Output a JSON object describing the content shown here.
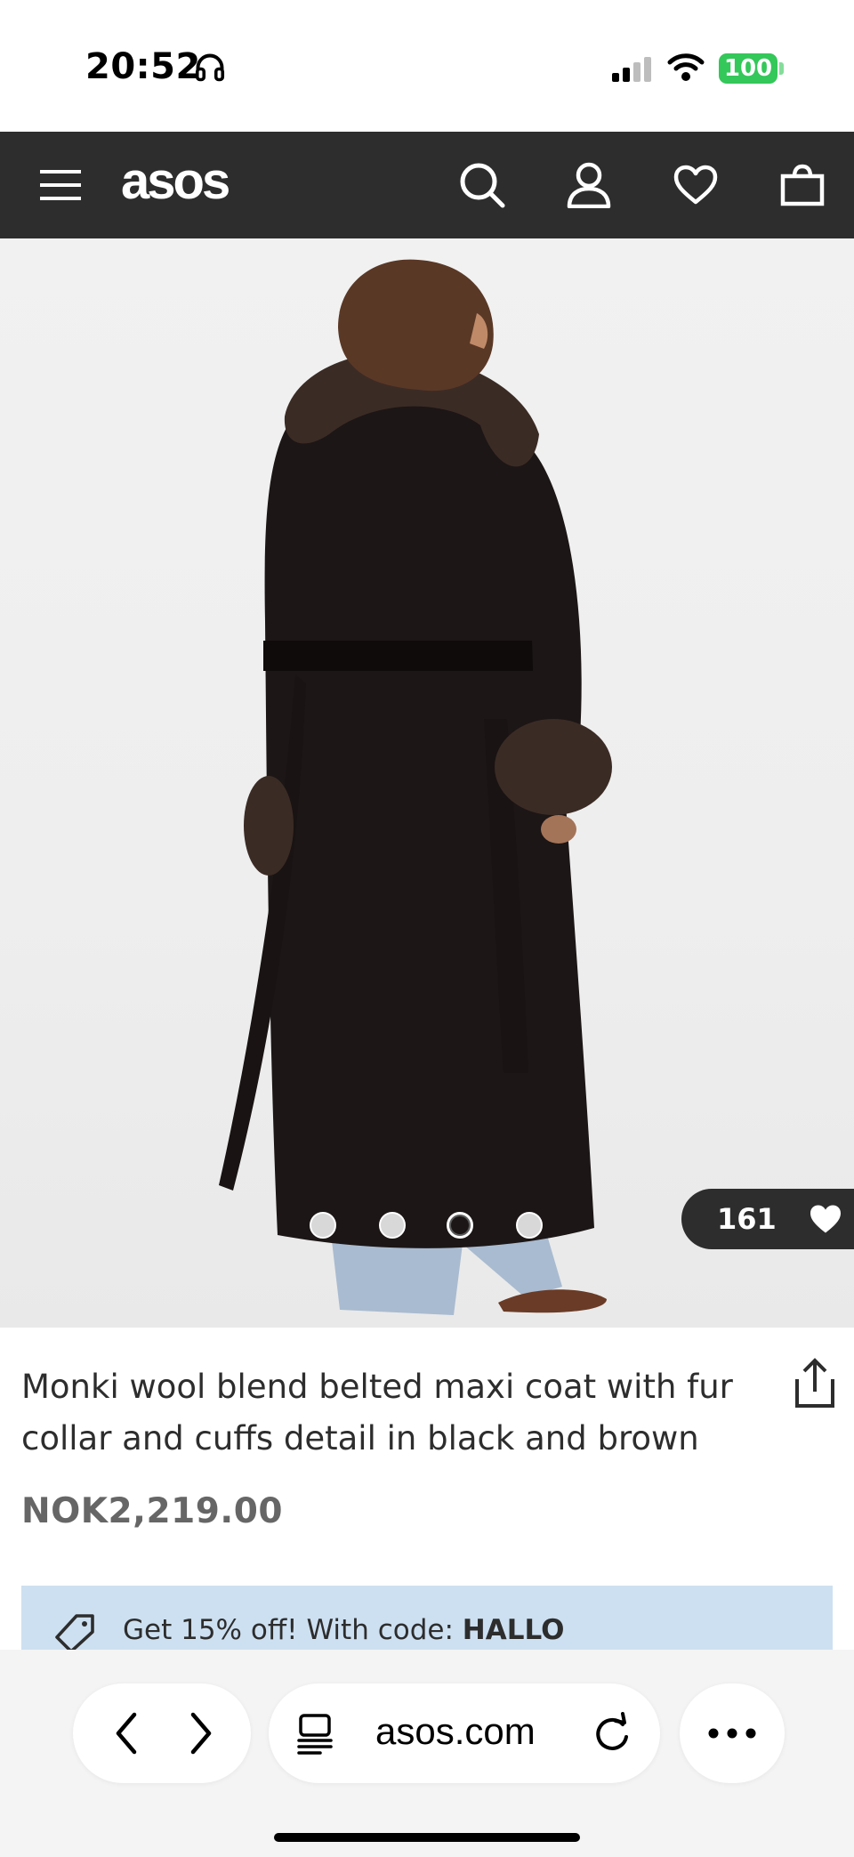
{
  "status_bar": {
    "time": "20:52",
    "battery": "100"
  },
  "header": {
    "logo": "asos",
    "background": "#2d2d2d",
    "icons": [
      "menu-icon",
      "search-icon",
      "account-icon",
      "heart-icon",
      "bag-icon"
    ]
  },
  "gallery": {
    "image_count": 4,
    "active_index": 2,
    "saves_count": "161"
  },
  "product": {
    "title": "Monki wool blend belted maxi coat with fur collar and cuffs detail in black and brown",
    "price": "NOK2,219.00"
  },
  "promo": {
    "text": "Get 15% off! With code: ",
    "code": "HALLO",
    "background": "#cde0f1"
  },
  "browser": {
    "url": "asos.com"
  }
}
